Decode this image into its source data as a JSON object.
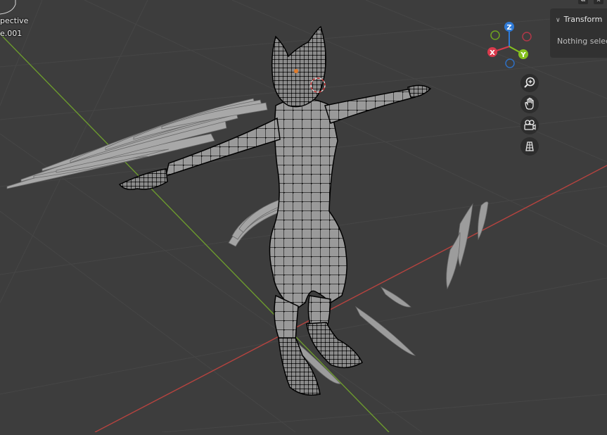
{
  "viewport": {
    "view_name": "pective",
    "object_name": "e.001",
    "background": "#3d3d3d",
    "grid_color": "#464646",
    "x_axis_color": "#b5433f",
    "y_axis_color": "#6c9a2e",
    "mesh_color": "#9e9e9e",
    "wire_color": "#0b0b0b",
    "selected_color": "#e07a2a"
  },
  "sidebar": {
    "panel_title": "Transform",
    "empty_message": "Nothing selec"
  },
  "topbar": {
    "close_label": "x"
  },
  "gizmo": {
    "z_label": "Z",
    "x_label": "X",
    "y_label": "Y",
    "z_color": "#2f7ad6",
    "x_color": "#d93a4c",
    "y_color": "#86c21f"
  },
  "nav_tools": [
    {
      "name": "zoom",
      "icon": "magnifier-plus-icon"
    },
    {
      "name": "pan",
      "icon": "hand-icon"
    },
    {
      "name": "camera",
      "icon": "camera-icon"
    },
    {
      "name": "ortho",
      "icon": "grid-icon"
    }
  ]
}
